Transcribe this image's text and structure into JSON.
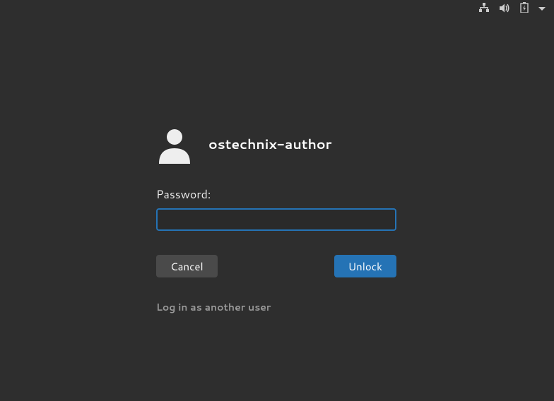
{
  "user": {
    "name": "ostechnix-author"
  },
  "labels": {
    "password": "Password:",
    "cancel": "Cancel",
    "unlock": "Unlock",
    "other_user": "Log in as another user"
  },
  "input": {
    "password_value": ""
  }
}
